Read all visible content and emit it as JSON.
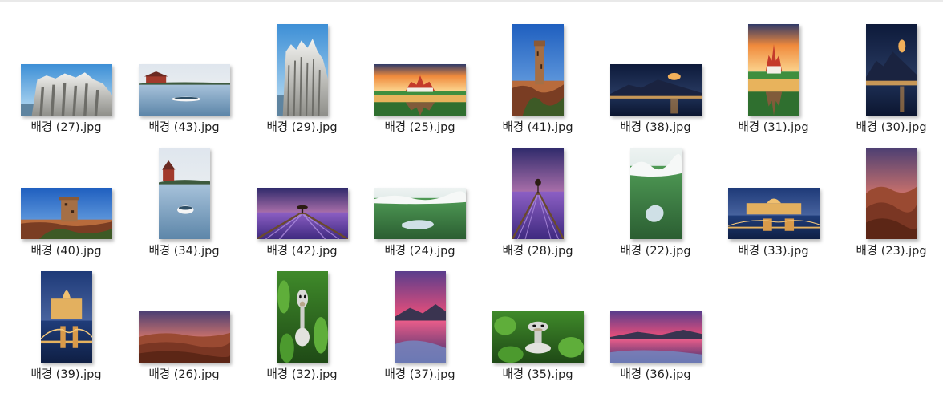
{
  "files": [
    {
      "name": "배경 (27).jpg",
      "scene": "white-rock-cliff",
      "orientation": "landscape"
    },
    {
      "name": "배경 (43).jpg",
      "scene": "lake-boat-house",
      "orientation": "landscape"
    },
    {
      "name": "배경 (29).jpg",
      "scene": "white-rock-cliff",
      "orientation": "portrait"
    },
    {
      "name": "배경 (25).jpg",
      "scene": "thai-palace-reflection",
      "orientation": "landscape"
    },
    {
      "name": "배경 (41).jpg",
      "scene": "desert-watchtower",
      "orientation": "portrait"
    },
    {
      "name": "배경 (38).jpg",
      "scene": "night-harbor-moon",
      "orientation": "landscape"
    },
    {
      "name": "배경 (31).jpg",
      "scene": "thai-palace-reflection",
      "orientation": "portrait"
    },
    {
      "name": "배경 (30).jpg",
      "scene": "night-harbor-moon",
      "orientation": "portrait"
    },
    {
      "name": "배경 (40).jpg",
      "scene": "desert-watchtower",
      "orientation": "landscape"
    },
    {
      "name": "배경 (34).jpg",
      "scene": "lake-boat-house",
      "orientation": "portrait"
    },
    {
      "name": "배경 (42).jpg",
      "scene": "lavender-field",
      "orientation": "landscape"
    },
    {
      "name": "배경 (24).jpg",
      "scene": "green-valley-lake",
      "orientation": "landscape"
    },
    {
      "name": "배경 (28).jpg",
      "scene": "lavender-field",
      "orientation": "portrait"
    },
    {
      "name": "배경 (22).jpg",
      "scene": "green-valley-lake",
      "orientation": "portrait"
    },
    {
      "name": "배경 (33).jpg",
      "scene": "budapest-bridge-night",
      "orientation": "landscape"
    },
    {
      "name": "배경 (23).jpg",
      "scene": "red-desert-dunes",
      "orientation": "portrait"
    },
    {
      "name": "배경 (39).jpg",
      "scene": "budapest-bridge-night",
      "orientation": "portrait"
    },
    {
      "name": "배경 (26).jpg",
      "scene": "red-desert-dunes",
      "orientation": "landscape"
    },
    {
      "name": "배경 (32).jpg",
      "scene": "ostrich-in-leaves",
      "orientation": "portrait"
    },
    {
      "name": "배경 (37).jpg",
      "scene": "pink-sunset-shore",
      "orientation": "portrait"
    },
    {
      "name": "배경 (35).jpg",
      "scene": "ostrich-in-leaves",
      "orientation": "landscape"
    },
    {
      "name": "배경 (36).jpg",
      "scene": "pink-sunset-shore",
      "orientation": "landscape"
    }
  ]
}
